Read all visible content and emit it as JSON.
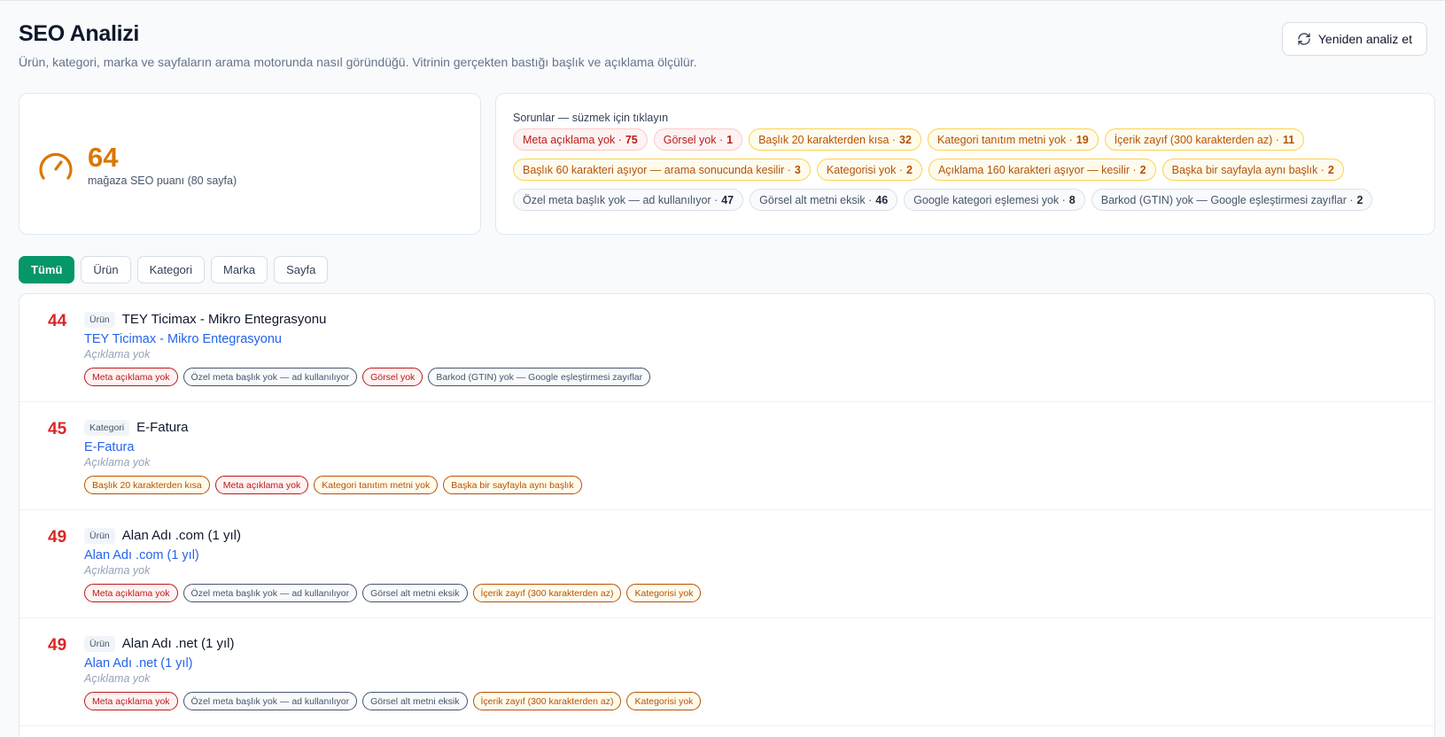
{
  "header": {
    "title": "SEO Analizi",
    "subtitle": "Ürün, kategori, marka ve sayfaların arama motorunda nasıl göründüğü. Vitrinin gerçekten bastığı başlık ve açıklama ölçülür.",
    "reanalyze_label": "Yeniden analiz et"
  },
  "score": {
    "value": "64",
    "caption": "mağaza SEO puanı (80 sayfa)",
    "color": "#d97706"
  },
  "issues": {
    "title": "Sorunlar — süzmek için tıklayın",
    "rows": [
      [
        {
          "label": "Meta açıklama yok ·",
          "count": "75",
          "tone": "red"
        },
        {
          "label": "Görsel yok ·",
          "count": "1",
          "tone": "red"
        },
        {
          "label": "Başlık 20 karakterden kısa ·",
          "count": "32",
          "tone": "amber"
        },
        {
          "label": "Kategori tanıtım metni yok ·",
          "count": "19",
          "tone": "amber"
        },
        {
          "label": "İçerik zayıf (300 karakterden az) ·",
          "count": "11",
          "tone": "amber"
        }
      ],
      [
        {
          "label": "Başlık 60 karakteri aşıyor — arama sonucunda kesilir ·",
          "count": "3",
          "tone": "amber"
        },
        {
          "label": "Kategorisi yok ·",
          "count": "2",
          "tone": "amber"
        },
        {
          "label": "Açıklama 160 karakteri aşıyor — kesilir ·",
          "count": "2",
          "tone": "amber"
        },
        {
          "label": "Başka bir sayfayla aynı başlık ·",
          "count": "2",
          "tone": "amber"
        }
      ],
      [
        {
          "label": "Özel meta başlık yok — ad kullanılıyor ·",
          "count": "47",
          "tone": "gray"
        },
        {
          "label": "Görsel alt metni eksik ·",
          "count": "46",
          "tone": "gray"
        },
        {
          "label": "Google kategori eşlemesi yok ·",
          "count": "8",
          "tone": "gray"
        },
        {
          "label": "Barkod (GTIN) yok — Google eşleştirmesi zayıflar ·",
          "count": "2",
          "tone": "gray"
        }
      ]
    ]
  },
  "filters": [
    {
      "label": "Tümü",
      "active": true
    },
    {
      "label": "Ürün",
      "active": false
    },
    {
      "label": "Kategori",
      "active": false
    },
    {
      "label": "Marka",
      "active": false
    },
    {
      "label": "Sayfa",
      "active": false
    }
  ],
  "items": [
    {
      "score": "44",
      "type": "Ürün",
      "name": "TEY Ticimax - Mikro Entegrasyonu",
      "link": "TEY Ticimax - Mikro Entegrasyonu",
      "desc": "Açıklama yok",
      "tags": [
        {
          "label": "Meta açıklama yok",
          "tone": "red"
        },
        {
          "label": "Özel meta başlık yok — ad kullanılıyor",
          "tone": "gray"
        },
        {
          "label": "Görsel yok",
          "tone": "red"
        },
        {
          "label": "Barkod (GTIN) yok — Google eşleştirmesi zayıflar",
          "tone": "gray"
        }
      ]
    },
    {
      "score": "45",
      "type": "Kategori",
      "name": "E-Fatura",
      "link": "E-Fatura",
      "desc": "Açıklama yok",
      "tags": [
        {
          "label": "Başlık 20 karakterden kısa",
          "tone": "amber"
        },
        {
          "label": "Meta açıklama yok",
          "tone": "red"
        },
        {
          "label": "Kategori tanıtım metni yok",
          "tone": "amber"
        },
        {
          "label": "Başka bir sayfayla aynı başlık",
          "tone": "amber"
        }
      ]
    },
    {
      "score": "49",
      "type": "Ürün",
      "name": "Alan Adı .com (1 yıl)",
      "link": "Alan Adı .com (1 yıl)",
      "desc": "Açıklama yok",
      "tags": [
        {
          "label": "Meta açıklama yok",
          "tone": "red"
        },
        {
          "label": "Özel meta başlık yok — ad kullanılıyor",
          "tone": "gray"
        },
        {
          "label": "Görsel alt metni eksik",
          "tone": "gray"
        },
        {
          "label": "İçerik zayıf (300 karakterden az)",
          "tone": "amber"
        },
        {
          "label": "Kategorisi yok",
          "tone": "amber"
        }
      ]
    },
    {
      "score": "49",
      "type": "Ürün",
      "name": "Alan Adı .net (1 yıl)",
      "link": "Alan Adı .net (1 yıl)",
      "desc": "Açıklama yok",
      "tags": [
        {
          "label": "Meta açıklama yok",
          "tone": "red"
        },
        {
          "label": "Özel meta başlık yok — ad kullanılıyor",
          "tone": "gray"
        },
        {
          "label": "Görsel alt metni eksik",
          "tone": "gray"
        },
        {
          "label": "İçerik zayıf (300 karakterden az)",
          "tone": "amber"
        },
        {
          "label": "Kategorisi yok",
          "tone": "amber"
        }
      ]
    }
  ]
}
